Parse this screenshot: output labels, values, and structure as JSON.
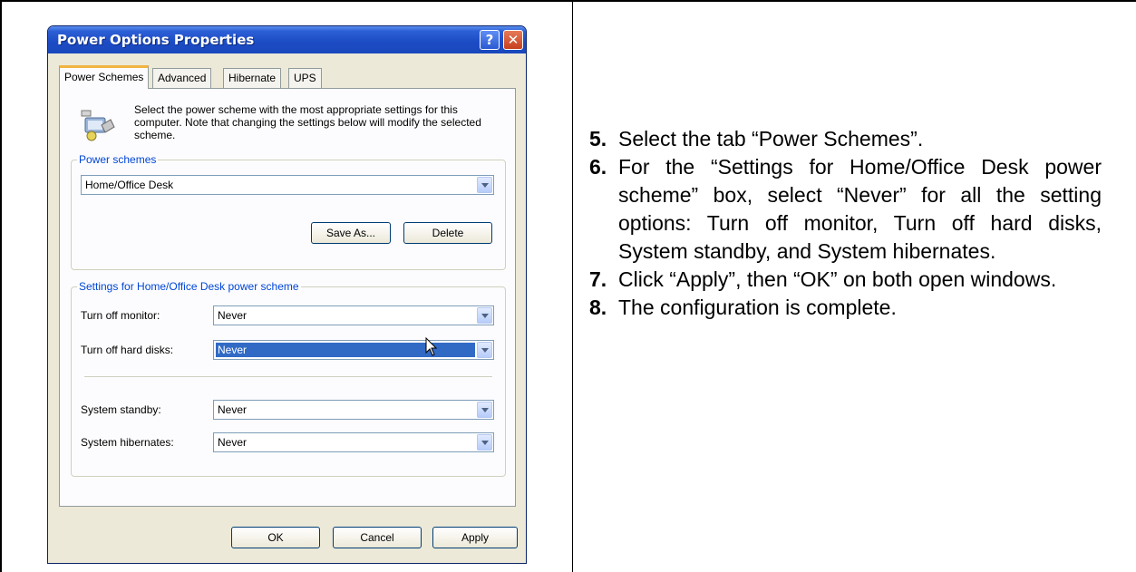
{
  "dialog": {
    "title": "Power Options Properties",
    "help_label": "?",
    "close_label": "✕",
    "tabs": [
      {
        "label": "Power Schemes",
        "active": true
      },
      {
        "label": "Advanced",
        "active": false
      },
      {
        "label": "Hibernate",
        "active": false
      },
      {
        "label": "UPS",
        "active": false
      }
    ],
    "description": "Select the power scheme with the most appropriate settings for this computer. Note that changing the settings below will modify the selected scheme.",
    "power_schemes": {
      "group_label": "Power schemes",
      "selected": "Home/Office Desk",
      "save_as_label": "Save As...",
      "delete_label": "Delete"
    },
    "settings": {
      "group_label": "Settings for Home/Office Desk power scheme",
      "rows": [
        {
          "label": "Turn off monitor:",
          "value": "Never"
        },
        {
          "label": "Turn off hard disks:",
          "value": "Never"
        },
        {
          "label": "System standby:",
          "value": "Never"
        },
        {
          "label": "System hibernates:",
          "value": "Never"
        }
      ]
    },
    "buttons": {
      "ok": "OK",
      "cancel": "Cancel",
      "apply": "Apply"
    },
    "colors": {
      "title_bar": "#1c4bc4",
      "highlight": "#316ac5",
      "group_label": "#0046d5"
    }
  },
  "instructions": [
    {
      "num": "5.",
      "text": "Select the tab “Power Schemes”."
    },
    {
      "num": "6.",
      "text": "For the “Settings for Home/Office Desk power scheme” box, select “Never” for all the setting options: Turn off monitor, Turn off hard disks, System standby, and System hibernates."
    },
    {
      "num": "7.",
      "text": "Click “Apply”, then “OK” on both open windows."
    },
    {
      "num": "8.",
      "text": "The configuration is complete."
    }
  ]
}
